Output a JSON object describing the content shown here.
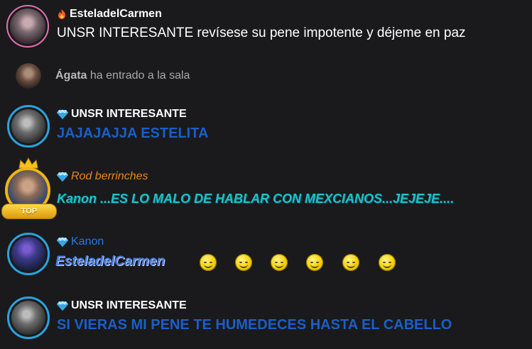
{
  "colors": {
    "background": "#1a1a1c",
    "blue_text": "#1a5fc8",
    "teal_text": "#1fc0c8",
    "orange_name": "#e9861b",
    "ring_blue": "#2aa3e0",
    "ring_pink": "#e56fb0"
  },
  "messages": [
    {
      "user": "EsteladelCarmen",
      "badge": "fire-badge-icon",
      "text": "UNSR INTERESANTE revísese su pene impotente y déjeme en paz"
    },
    {
      "type": "join",
      "user": "Ágata",
      "text": "ha entrado a la sala"
    },
    {
      "user": "UNSR INTERESANTE",
      "badge": "diamond-icon",
      "text": "JAJAJAJJA ESTELITA"
    },
    {
      "user": "Rod berrinches",
      "badge": "diamond-icon",
      "frame": "TOP",
      "text": "Kanon ...ES LO MALO DE HABLAR CON MEXCIANOS...JEJEJE...."
    },
    {
      "user": "Kanon",
      "badge": "diamond-icon",
      "mention": "EsteladelCarmen",
      "emojis": [
        "smiley",
        "smiley",
        "smiley",
        "smiley",
        "smiley",
        "smiley"
      ]
    },
    {
      "user": "UNSR INTERESANTE",
      "badge": "diamond-icon",
      "text": "SI VIERAS MI PENE TE HUMEDECES HASTA EL CABELLO"
    }
  ]
}
